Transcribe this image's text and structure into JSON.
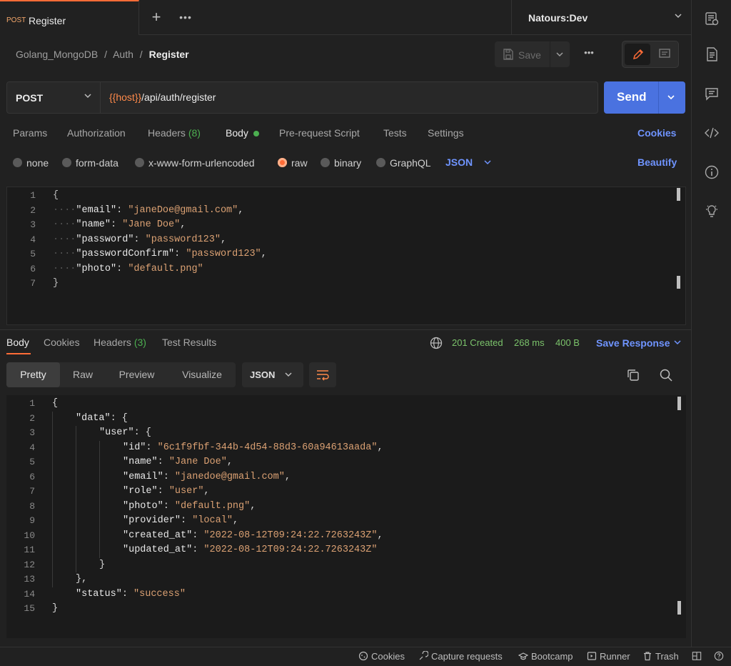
{
  "tab": {
    "method": "POST",
    "name": "Register"
  },
  "environment": "Natours:Dev",
  "breadcrumb": {
    "collection": "Golang_MongoDB",
    "folder": "Auth",
    "current": "Register",
    "sep": "/"
  },
  "toolbar": {
    "save_label": "Save"
  },
  "request": {
    "method": "POST",
    "url_var": "{{host}}",
    "url_path": "/api/auth/register",
    "send_label": "Send"
  },
  "request_tabs": {
    "params": "Params",
    "authorization": "Authorization",
    "headers": "Headers",
    "headers_count": "(8)",
    "body": "Body",
    "pre_request": "Pre-request Script",
    "tests": "Tests",
    "settings": "Settings",
    "cookies": "Cookies"
  },
  "body_types": {
    "none": "none",
    "form_data": "form-data",
    "urlencoded": "x-www-form-urlencoded",
    "raw": "raw",
    "binary": "binary",
    "graphql": "GraphQL",
    "selected": "raw",
    "language": "JSON",
    "beautify": "Beautify"
  },
  "request_body_lines": [
    {
      "n": "1",
      "text": "{"
    },
    {
      "n": "2",
      "key": "\"email\"",
      "val": "\"janeDoe@gmail.com\"",
      "tail": ","
    },
    {
      "n": "3",
      "key": "\"name\"",
      "val": "\"Jane Doe\"",
      "tail": ","
    },
    {
      "n": "4",
      "key": "\"password\"",
      "val": "\"password123\"",
      "tail": ","
    },
    {
      "n": "5",
      "key": "\"passwordConfirm\"",
      "val": "\"password123\"",
      "tail": ","
    },
    {
      "n": "6",
      "key": "\"photo\"",
      "val": "\"default.png\"",
      "tail": ""
    },
    {
      "n": "7",
      "text": "}"
    }
  ],
  "response": {
    "tabs": {
      "body": "Body",
      "cookies": "Cookies",
      "headers": "Headers",
      "headers_count": "(3)",
      "test_results": "Test Results"
    },
    "status": "201 Created",
    "time": "268 ms",
    "size": "400 B",
    "save_response": "Save Response",
    "views": {
      "pretty": "Pretty",
      "raw": "Raw",
      "preview": "Preview",
      "visualize": "Visualize"
    },
    "format": "JSON",
    "lines": [
      {
        "n": "1",
        "indent": 0,
        "text": "{"
      },
      {
        "n": "2",
        "indent": 1,
        "key": "\"data\"",
        "after": ": {"
      },
      {
        "n": "3",
        "indent": 2,
        "key": "\"user\"",
        "after": ": {"
      },
      {
        "n": "4",
        "indent": 3,
        "key": "\"id\"",
        "val": "\"6c1f9fbf-344b-4d54-88d3-60a94613aada\"",
        "tail": ","
      },
      {
        "n": "5",
        "indent": 3,
        "key": "\"name\"",
        "val": "\"Jane Doe\"",
        "tail": ","
      },
      {
        "n": "6",
        "indent": 3,
        "key": "\"email\"",
        "val": "\"janedoe@gmail.com\"",
        "tail": ","
      },
      {
        "n": "7",
        "indent": 3,
        "key": "\"role\"",
        "val": "\"user\"",
        "tail": ","
      },
      {
        "n": "8",
        "indent": 3,
        "key": "\"photo\"",
        "val": "\"default.png\"",
        "tail": ","
      },
      {
        "n": "9",
        "indent": 3,
        "key": "\"provider\"",
        "val": "\"local\"",
        "tail": ","
      },
      {
        "n": "10",
        "indent": 3,
        "key": "\"created_at\"",
        "val": "\"2022-08-12T09:24:22.7263243Z\"",
        "tail": ","
      },
      {
        "n": "11",
        "indent": 3,
        "key": "\"updated_at\"",
        "val": "\"2022-08-12T09:24:22.7263243Z\"",
        "tail": ""
      },
      {
        "n": "12",
        "indent": 2,
        "text": "}"
      },
      {
        "n": "13",
        "indent": 1,
        "text": "},"
      },
      {
        "n": "14",
        "indent": 1,
        "key": "\"status\"",
        "val": "\"success\"",
        "tail": ""
      },
      {
        "n": "15",
        "indent": 0,
        "text": "}"
      }
    ]
  },
  "statusbar": {
    "cookies": "Cookies",
    "capture": "Capture requests",
    "bootcamp": "Bootcamp",
    "runner": "Runner",
    "trash": "Trash"
  },
  "colors": {
    "accent": "#ff6c37",
    "primary": "#4a72e0",
    "link": "#6f94ff",
    "success": "#7bc36b"
  }
}
